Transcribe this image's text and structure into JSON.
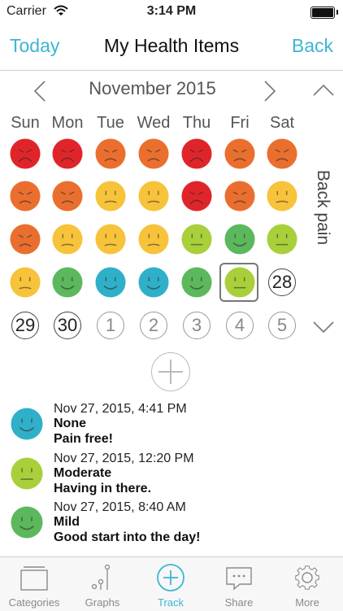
{
  "status": {
    "carrier": "Carrier",
    "time": "3:14 PM"
  },
  "nav": {
    "left": "Today",
    "title": "My Health Items",
    "right": "Back"
  },
  "calendar": {
    "month": "November 2015",
    "weekdays": [
      "Sun",
      "Mon",
      "Tue",
      "Wed",
      "Thu",
      "Fri",
      "Sat"
    ],
    "tracked_item": "Back pain",
    "colors": {
      "red": "#e0252a",
      "orange": "#ea6f2f",
      "yellow": "#f7c33a",
      "lime": "#a9cf3b",
      "green": "#5cb85c",
      "teal": "#2fb0c8"
    },
    "mood_rows": [
      [
        "red",
        "red",
        "orange",
        "orange",
        "red",
        "orange",
        "orange"
      ],
      [
        "orange",
        "orange",
        "yellow",
        "yellow",
        "red",
        "orange",
        "yellow"
      ],
      [
        "orange",
        "yellow",
        "yellow",
        "yellow",
        "lime",
        "green",
        "lime"
      ],
      [
        "yellow",
        "green",
        "teal",
        "teal",
        "green",
        "lime"
      ]
    ],
    "days": [
      {
        "label": "28",
        "muted": false
      },
      {
        "label": "29",
        "muted": false
      },
      {
        "label": "30",
        "muted": false
      },
      {
        "label": "1",
        "muted": true
      },
      {
        "label": "2",
        "muted": true
      },
      {
        "label": "3",
        "muted": true
      },
      {
        "label": "4",
        "muted": true
      },
      {
        "label": "5",
        "muted": true
      }
    ]
  },
  "entries": [
    {
      "timestamp": "Nov 27, 2015, 4:41 PM",
      "level": "None",
      "note": "Pain free!",
      "color": "#2fb0c8",
      "mood": "smile"
    },
    {
      "timestamp": "Nov 27, 2015, 12:20 PM",
      "level": "Moderate",
      "note": "Having in there.",
      "color": "#a9cf3b",
      "mood": "neutral"
    },
    {
      "timestamp": "Nov 27, 2015, 8:40 AM",
      "level": "Mild",
      "note": "Good start into the day!",
      "color": "#5cb85c",
      "mood": "smile"
    }
  ],
  "tabs": [
    {
      "label": "Categories",
      "icon": "categories-icon"
    },
    {
      "label": "Graphs",
      "icon": "graphs-icon"
    },
    {
      "label": "Track",
      "icon": "track-icon",
      "active": true
    },
    {
      "label": "Share",
      "icon": "share-icon"
    },
    {
      "label": "More",
      "icon": "more-icon"
    }
  ]
}
